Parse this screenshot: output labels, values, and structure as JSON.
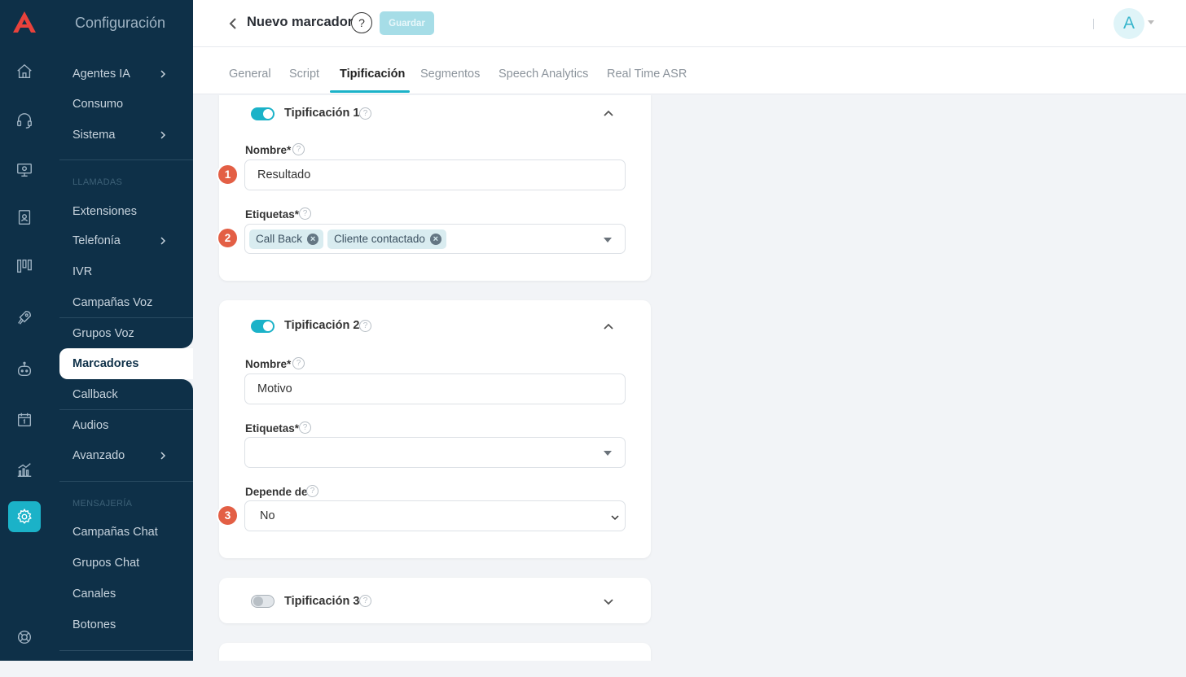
{
  "sidebar": {
    "title": "Configuración",
    "items_top": [
      {
        "label": "Agentes IA",
        "has_children": true
      },
      {
        "label": "Consumo",
        "has_children": false
      },
      {
        "label": "Sistema",
        "has_children": true
      }
    ],
    "section_calls": "LLAMADAS",
    "items_calls": [
      {
        "label": "Extensiones",
        "has_children": false
      },
      {
        "label": "Telefonía",
        "has_children": true
      },
      {
        "label": "IVR",
        "has_children": false
      },
      {
        "label": "Campañas Voz",
        "has_children": false
      },
      {
        "label": "Grupos Voz",
        "has_children": false
      },
      {
        "label": "Marcadores",
        "has_children": false,
        "active": true
      },
      {
        "label": "Callback",
        "has_children": false
      },
      {
        "label": "Audios",
        "has_children": false
      },
      {
        "label": "Avanzado",
        "has_children": true
      }
    ],
    "section_messaging": "MENSAJERÍA",
    "items_messaging": [
      {
        "label": "Campañas Chat"
      },
      {
        "label": "Grupos Chat"
      },
      {
        "label": "Canales"
      },
      {
        "label": "Botones"
      }
    ]
  },
  "rail_icons": [
    "home-icon",
    "headset-icon",
    "monitor-icon",
    "contacts-icon",
    "boards-icon",
    "rocket-icon",
    "robot-icon",
    "calendar-icon",
    "analytics-icon",
    "settings-icon",
    "support-icon"
  ],
  "header": {
    "title": "Nuevo marcador",
    "help": "?",
    "save_label": "Guardar",
    "avatar_initial": "A"
  },
  "tabs": [
    "General",
    "Script",
    "Tipificación",
    "Segmentos",
    "Speech Analytics",
    "Real Time ASR"
  ],
  "active_tab": "Tipificación",
  "tipificaciones": [
    {
      "title": "Tipificación 1",
      "enabled": true,
      "name_label": "Nombre*",
      "name_value": "Resultado",
      "tags_label": "Etiquetas*",
      "tags": [
        "Call Back",
        "Cliente contactado"
      ]
    },
    {
      "title": "Tipificación 2",
      "enabled": true,
      "name_label": "Nombre*",
      "name_value": "Motivo",
      "tags_label": "Etiquetas*",
      "tags": [],
      "depends_label": "Depende de",
      "depends_value": "No"
    },
    {
      "title": "Tipificación 3",
      "enabled": false
    }
  ],
  "badges": [
    "1",
    "2",
    "3"
  ],
  "colors": {
    "sidebar_bg": "#0e3048",
    "accent": "#1bb2c8",
    "badge": "#e35f45",
    "save_disabled": "#a6dde7"
  }
}
